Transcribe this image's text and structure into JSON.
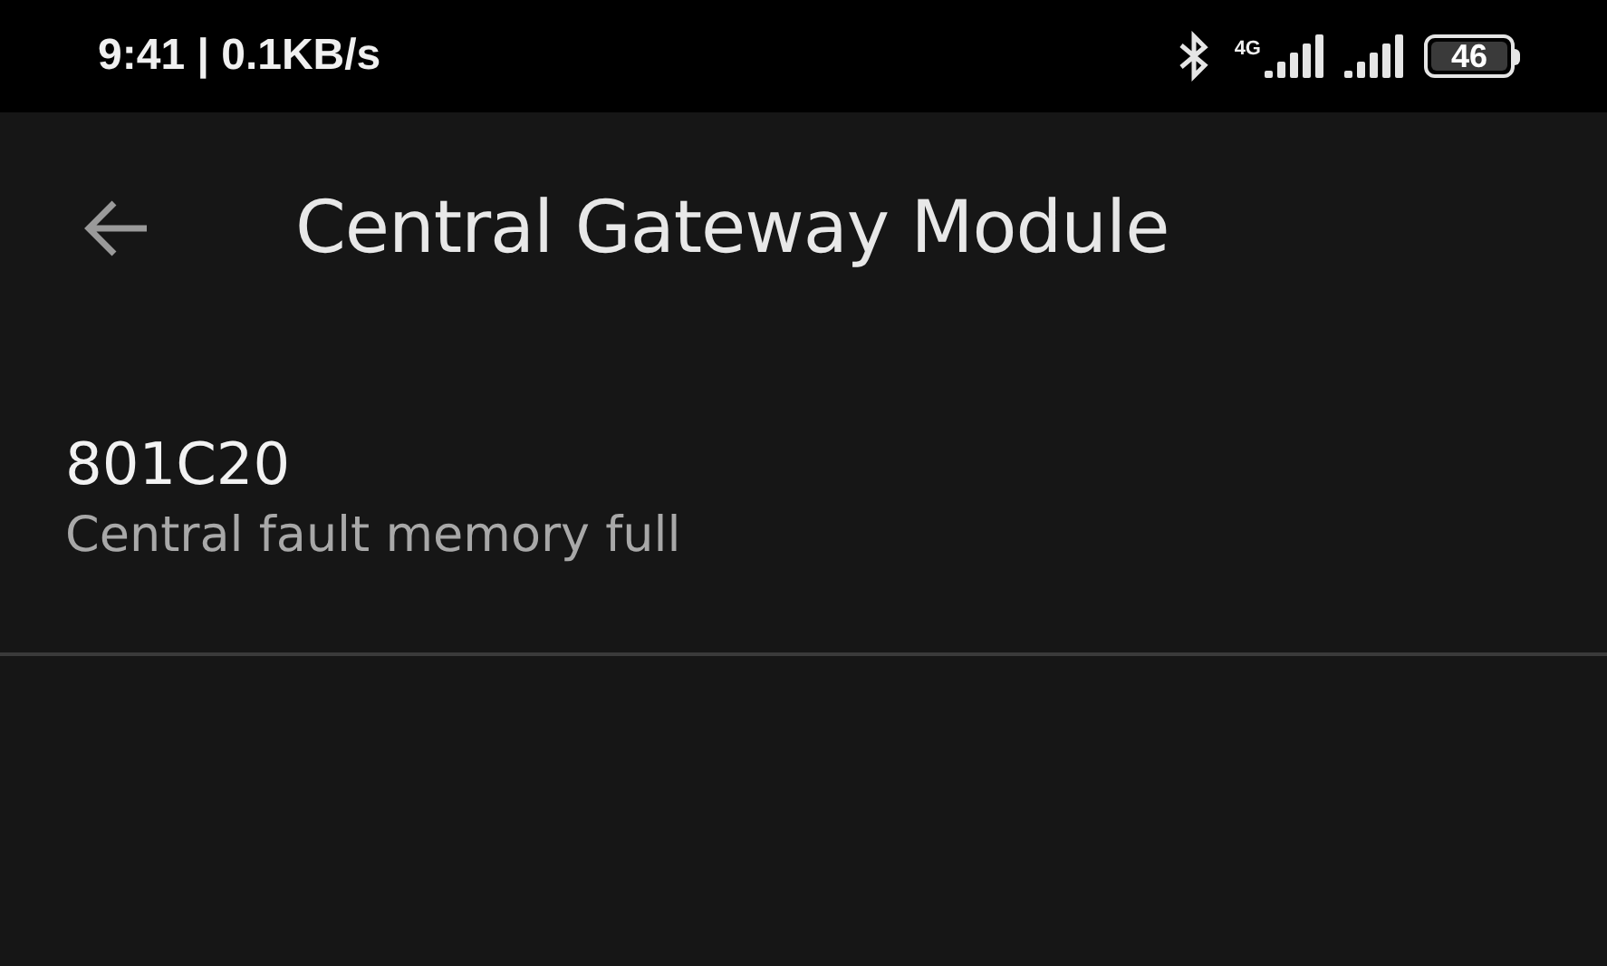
{
  "status_bar": {
    "time": "9:41",
    "separator": "|",
    "speed": "0.1KB/s",
    "network": "4G",
    "battery": "46"
  },
  "app_bar": {
    "title": "Central Gateway Module"
  },
  "faults": [
    {
      "code": "801C20",
      "description": "Central fault memory full"
    }
  ]
}
